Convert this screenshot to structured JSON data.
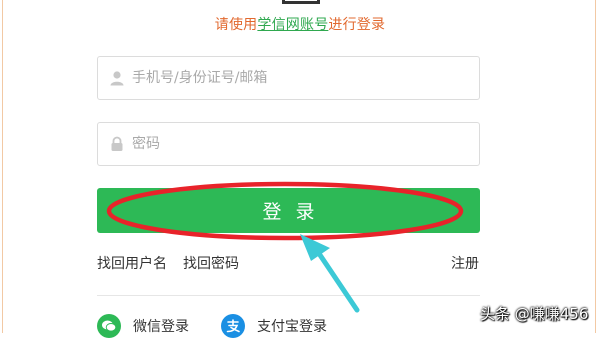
{
  "notice": {
    "prefix": "请使用",
    "link": "学信网账号",
    "suffix": "进行登录"
  },
  "fields": {
    "account_placeholder": "手机号/身份证号/邮箱",
    "password_placeholder": "密码"
  },
  "login_button": "登录",
  "links": {
    "find_username": "找回用户名",
    "find_password": "找回密码",
    "register": "注册"
  },
  "social": {
    "wechat": "微信登录",
    "alipay": "支付宝登录"
  },
  "watermark": "头条 @嗛嗛456",
  "colors": {
    "notice": "#e2692f",
    "link": "#2fa84f",
    "button": "#2db956",
    "annotation_ellipse": "#e8232a",
    "annotation_arrow": "#3cc9d6"
  },
  "icons": {
    "account": "user-icon",
    "password": "lock-icon",
    "wechat": "wechat-icon",
    "alipay": "alipay-icon"
  }
}
